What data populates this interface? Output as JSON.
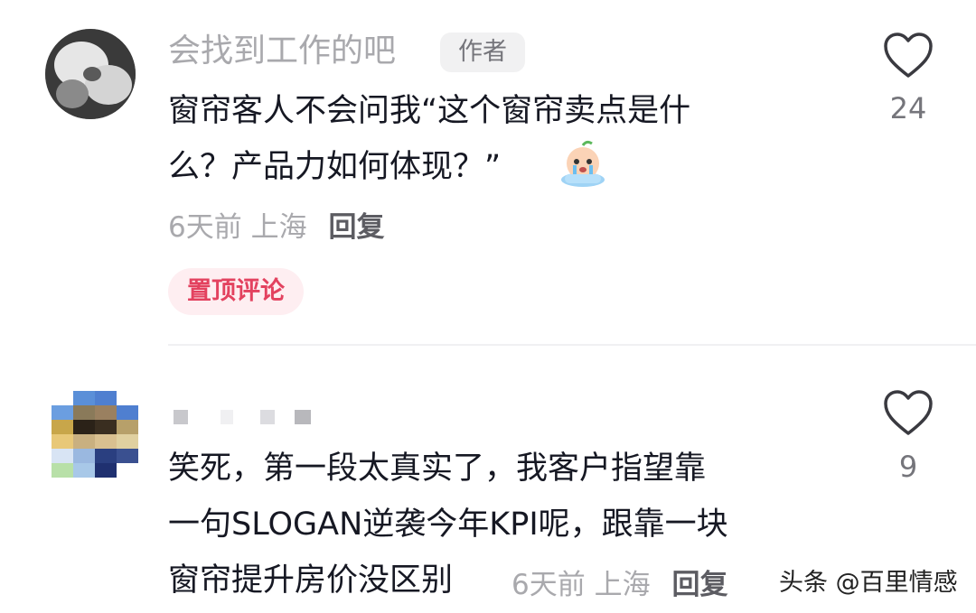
{
  "comments": [
    {
      "username": "会找到工作的吧",
      "author_badge": "作者",
      "text_line1": "窗帘客人不会问我“这个窗帘卖点是什",
      "text_line2": "么？产品力如何体现？”",
      "emoji": "crying-face-emoji",
      "time": "6天前",
      "location": "上海",
      "reply_label": "回复",
      "pinned_label": "置顶评论",
      "likes": "24",
      "like_icon": "heart-outline-icon"
    },
    {
      "text_line1": "笑死，第一段太真实了，我客户指望靠",
      "text_line2": "一句SLOGAN逆袭今年KPI呢，跟靠一块",
      "text_line3": "窗帘提升房价没区别",
      "time": "6天前",
      "location": "上海",
      "reply_label": "回复",
      "likes": "9",
      "like_icon": "heart-outline-icon"
    }
  ],
  "watermark": "头条 @百里情感",
  "colors": {
    "text_primary": "#161823",
    "text_secondary": "#a9a9ad",
    "pin_badge_bg": "#feeef1",
    "pin_badge_text": "#e3425f"
  }
}
